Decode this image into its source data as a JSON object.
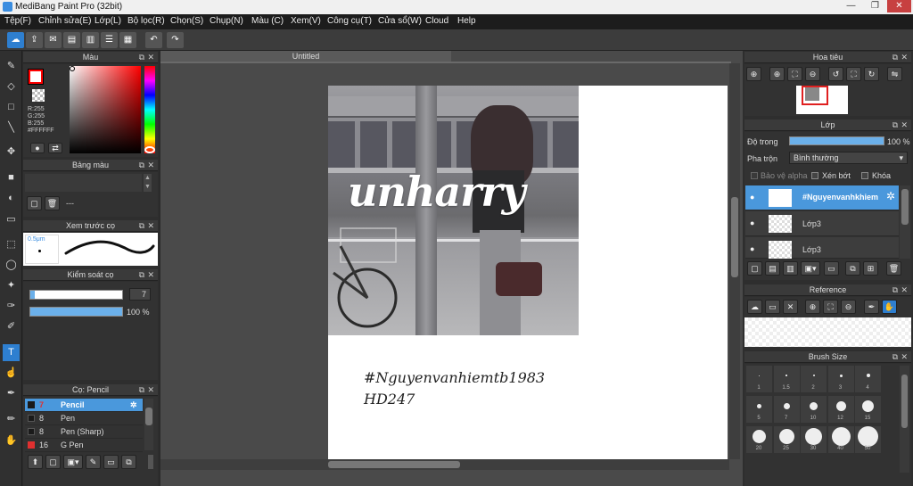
{
  "window": {
    "title": "MediBang Paint Pro (32bit)",
    "minimize": "—",
    "maximize": "❐",
    "close": "✕"
  },
  "menu": [
    "Tệp(F)",
    "Chỉnh sửa(E)",
    "Lớp(L)",
    "Bộ lọc(R)",
    "Chọn(S)",
    "Chụp(N)",
    "Màu (C)",
    "Xem(V)",
    "Công cụ(T)",
    "Cửa sổ(W)",
    "Cloud",
    "Help"
  ],
  "canvas": {
    "tab": "Untitled",
    "photo_text": "unharry",
    "caption1": "#Nguyenvanhiemtb1983",
    "caption2": "HD247"
  },
  "color_panel": {
    "title": "Màu",
    "r": "R:255",
    "g": "G:255",
    "b": "B:255",
    "hex": "#FFFFFF",
    "primary": "#ff0000",
    "secondary": "#ffffff"
  },
  "palette_panel": {
    "title": "Bảng màu",
    "empty": "---"
  },
  "brush_preview": {
    "title": "Xem trước cọ",
    "size": "0.5μm"
  },
  "brush_control": {
    "title": "Kiểm soát cọ",
    "size_value": "7",
    "opacity_value": "100 %",
    "size_fraction": 0.05,
    "opacity_fraction": 1.0
  },
  "brush_list": {
    "title": "Cọ: Pencil",
    "items": [
      {
        "size": "7",
        "name": "Pencil",
        "color": "#1a1a1a"
      },
      {
        "size": "8",
        "name": "Pen",
        "color": "#1a1a1a"
      },
      {
        "size": "8",
        "name": "Pen (Sharp)",
        "color": "#1a1a1a"
      },
      {
        "size": "16",
        "name": "G Pen",
        "color": "#e03030"
      }
    ]
  },
  "navigator": {
    "title": "Hoa tiêu"
  },
  "layers": {
    "title": "Lớp",
    "opacity_label": "Độ trong",
    "opacity_value": "100 %",
    "opacity_fraction": 1.0,
    "blend_label": "Pha trộn",
    "blend_value": "Bình thường",
    "protect_alpha": "Bảo vệ alpha",
    "clipping": "Xén bớt",
    "lock": "Khóa",
    "items": [
      {
        "name": "#Nguyenvanhkhiem"
      },
      {
        "name": "Lớp3"
      },
      {
        "name": "Lớp3"
      }
    ]
  },
  "reference": {
    "title": "Reference"
  },
  "brush_size": {
    "title": "Brush Size",
    "labels": [
      "1",
      "1.5",
      "2",
      "3",
      "4",
      "5",
      "7",
      "10",
      "12",
      "15",
      "20",
      "25",
      "30",
      "40",
      "50"
    ]
  }
}
